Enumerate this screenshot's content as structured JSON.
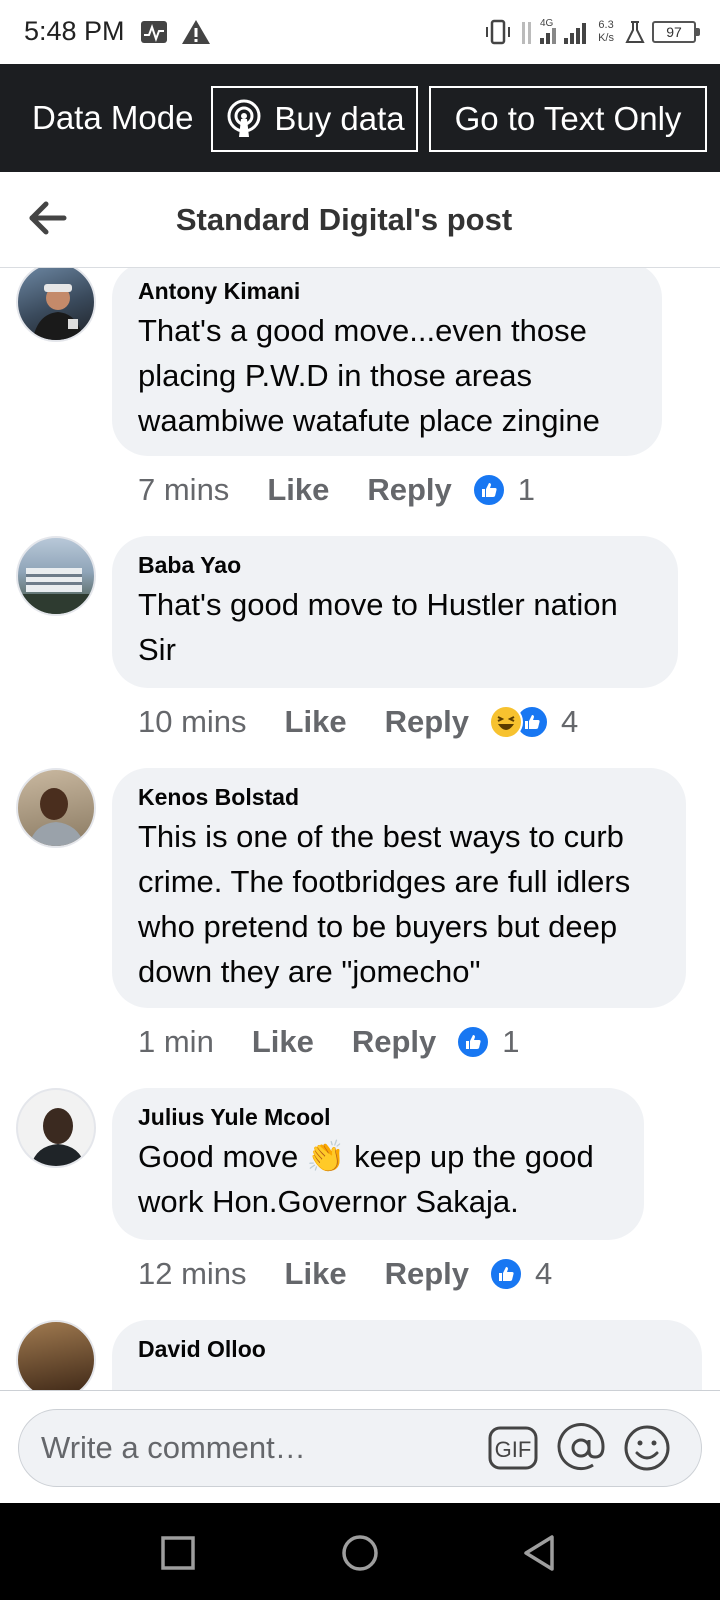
{
  "status_bar": {
    "time": "5:48 PM",
    "network": "4G",
    "speed_value": "6.3",
    "speed_unit": "K/s",
    "battery": "97",
    "icons": [
      "activity-icon",
      "warning-icon",
      "vibrate-icon",
      "signal-icon",
      "lab-icon",
      "battery-icon"
    ]
  },
  "data_bar": {
    "mode_label": "Data Mode",
    "buy_data_label": "Buy data",
    "text_only_label": "Go to Text Only"
  },
  "header": {
    "title": "Standard Digital's post"
  },
  "comments": [
    {
      "author": "Antony Kimani",
      "text": "That's a good move...even those placing P.W.D in those areas waambiwe watafute place zingine",
      "time": "7 mins",
      "like_label": "Like",
      "reply_label": "Reply",
      "reactions": [
        "like"
      ],
      "reaction_count": "1"
    },
    {
      "author": "Baba Yao",
      "text": "That's good move to Hustler nation Sir",
      "time": "10 mins",
      "like_label": "Like",
      "reply_label": "Reply",
      "reactions": [
        "haha",
        "like"
      ],
      "reaction_count": "4"
    },
    {
      "author": "Kenos Bolstad",
      "text": "This is one of the best ways to curb crime. The footbridges are full idlers who pretend to be buyers but deep down they are \"jomecho\"",
      "time": "1 min",
      "like_label": "Like",
      "reply_label": "Reply",
      "reactions": [
        "like"
      ],
      "reaction_count": "1"
    },
    {
      "author": "Julius Yule Mcool",
      "text_before_emoji": "Good move ",
      "emoji": "👏",
      "text_after_emoji": " keep up the good work Hon.Governor Sakaja.",
      "time": "12 mins",
      "like_label": "Like",
      "reply_label": "Reply",
      "reactions": [
        "like"
      ],
      "reaction_count": "4"
    },
    {
      "author": "David Olloo"
    }
  ],
  "composer": {
    "placeholder": "Write a comment…",
    "icons": [
      "gif-icon",
      "mention-icon",
      "emoji-icon"
    ]
  },
  "nav": {
    "icons": [
      "recents-icon",
      "home-icon",
      "back-icon"
    ]
  },
  "colors": {
    "facebook_blue": "#1877f2",
    "dark_bar": "#1c1e21",
    "bubble": "#f0f2f5",
    "meta_gray": "#65676b"
  }
}
